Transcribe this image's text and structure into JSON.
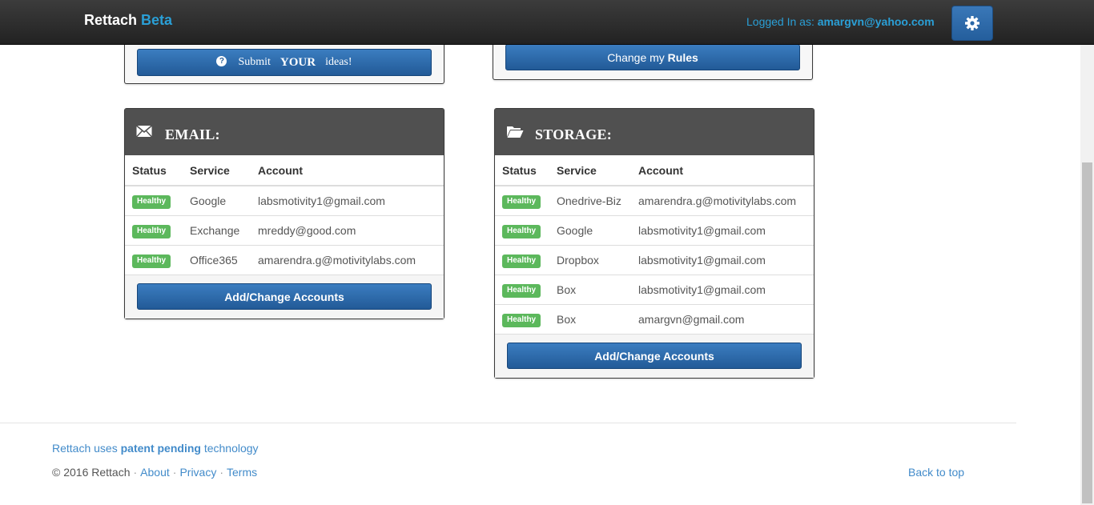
{
  "navbar": {
    "brand": "Rettach",
    "brand_beta": "Beta",
    "logged_in_label": "Logged In as:",
    "logged_in_user": "amargvn@yahoo.com",
    "settings_icon": "gear-icon"
  },
  "top_left_panel": {
    "button_pre": "Submit",
    "button_emph": "YOUR",
    "button_post": "ideas!",
    "icon": "question-circle-icon"
  },
  "top_right_panel": {
    "button_pre": "Change my",
    "button_emph": "Rules"
  },
  "email_panel": {
    "title": "EMAIL:",
    "icon": "envelope-icon",
    "columns": [
      "Status",
      "Service",
      "Account"
    ],
    "rows": [
      {
        "status": "Healthy",
        "service": "Google",
        "account": "labsmotivity1@gmail.com"
      },
      {
        "status": "Healthy",
        "service": "Exchange",
        "account": "mreddy@good.com"
      },
      {
        "status": "Healthy",
        "service": "Office365",
        "account": "amarendra.g@motivitylabs.com"
      }
    ],
    "button": "Add/Change Accounts"
  },
  "storage_panel": {
    "title": "STORAGE:",
    "icon": "folder-open-icon",
    "columns": [
      "Status",
      "Service",
      "Account"
    ],
    "rows": [
      {
        "status": "Healthy",
        "service": "Onedrive-Biz",
        "account": "amarendra.g@motivitylabs.com"
      },
      {
        "status": "Healthy",
        "service": "Google",
        "account": "labsmotivity1@gmail.com"
      },
      {
        "status": "Healthy",
        "service": "Dropbox",
        "account": "labsmotivity1@gmail.com"
      },
      {
        "status": "Healthy",
        "service": "Box",
        "account": "labsmotivity1@gmail.com"
      },
      {
        "status": "Healthy",
        "service": "Box",
        "account": "amargvn@gmail.com"
      }
    ],
    "button": "Add/Change Accounts"
  },
  "footer": {
    "uses_pre": "Rettach uses",
    "uses_emph": "patent pending",
    "uses_post": "technology",
    "copyright": "© 2016 Rettach",
    "links": [
      "About",
      "Privacy",
      "Terms"
    ],
    "back_to_top": "Back to top"
  },
  "colors": {
    "accent": "#2a9fd6",
    "button": "#2b6aab",
    "healthy": "#5cb85c",
    "panel_header": "#505050"
  }
}
